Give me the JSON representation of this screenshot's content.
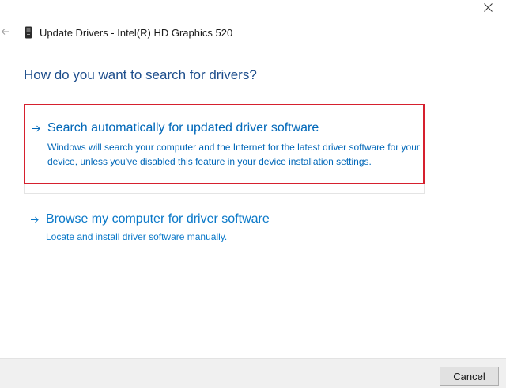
{
  "window": {
    "title": "Update Drivers - Intel(R) HD Graphics 520",
    "icons": {
      "close": "close-icon",
      "back": "back-arrow-icon",
      "device": "graphics-device-icon"
    }
  },
  "main": {
    "question": "How do you want to search for drivers?",
    "options": [
      {
        "title": "Search automatically for updated driver software",
        "description": "Windows will search your computer and the Internet for the latest driver software for your device, unless you've disabled this feature in your device installation settings.",
        "icon": "arrow-right-icon",
        "highlighted": true
      },
      {
        "title": "Browse my computer for driver software",
        "description": "Locate and install driver software manually.",
        "icon": "arrow-right-icon",
        "highlighted": false
      }
    ]
  },
  "footer": {
    "cancel_label": "Cancel"
  },
  "colors": {
    "link": "#0067b8",
    "question": "#1e4e8c",
    "highlight_border": "#d6202e",
    "footer_bg": "#f0f0f0"
  }
}
